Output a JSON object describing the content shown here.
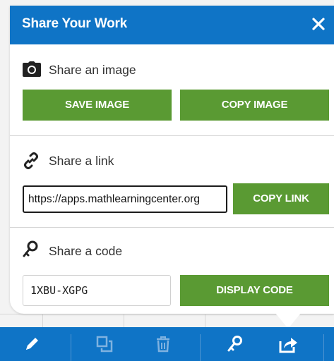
{
  "dialog": {
    "title": "Share Your Work"
  },
  "image_section": {
    "title": "Share an image",
    "save_label": "SAVE IMAGE",
    "copy_label": "COPY IMAGE"
  },
  "link_section": {
    "title": "Share a link",
    "url": "https://apps.mathlearningcenter.org",
    "copy_label": "COPY LINK"
  },
  "code_section": {
    "title": "Share a code",
    "code": "1XBU-XGPG",
    "display_label": "DISPLAY CODE"
  },
  "toolbar": {
    "items": [
      "pencil-icon",
      "duplicate-icon",
      "trash-icon",
      "key-icon",
      "share-icon"
    ]
  },
  "colors": {
    "header": "#0f74c6",
    "button": "#5a9a33"
  }
}
